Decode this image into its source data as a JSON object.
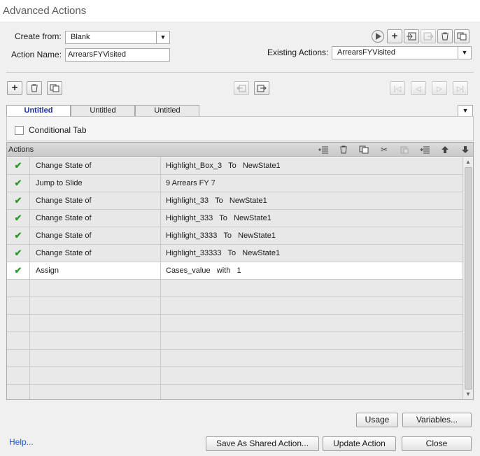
{
  "window": {
    "title": "Advanced Actions"
  },
  "form": {
    "create_from_label": "Create from:",
    "create_from_value": "Blank",
    "action_name_label": "Action Name:",
    "action_name_value": "ArrearsFYVisited",
    "existing_actions_label": "Existing Actions:",
    "existing_actions_value": "ArrearsFYVisited"
  },
  "tabs": [
    {
      "label": "Untitled",
      "active": true
    },
    {
      "label": "Untitled",
      "active": false
    },
    {
      "label": "Untitled",
      "active": false
    }
  ],
  "conditional_tab": {
    "label": "Conditional Tab",
    "checked": false
  },
  "actions_grid": {
    "header": "Actions",
    "rows": [
      {
        "status": "✔",
        "action": "Change State of",
        "params": "Highlight_Box_3   To   NewState1"
      },
      {
        "status": "✔",
        "action": "Jump to Slide",
        "params": "9 Arrears FY 7"
      },
      {
        "status": "✔",
        "action": "Change State of",
        "params": "Highlight_33   To   NewState1"
      },
      {
        "status": "✔",
        "action": "Change State of",
        "params": "Highlight_333   To   NewState1"
      },
      {
        "status": "✔",
        "action": "Change State of",
        "params": "Highlight_3333   To   NewState1"
      },
      {
        "status": "✔",
        "action": "Change State of",
        "params": "Highlight_33333   To   NewState1"
      },
      {
        "status": "✔",
        "action": "Assign",
        "params": "Cases_value   with   1"
      }
    ],
    "selected_row": 6,
    "empty_rows": 7
  },
  "buttons": {
    "usage": "Usage",
    "variables": "Variables...",
    "save_shared": "Save As Shared Action...",
    "update": "Update Action",
    "close": "Close",
    "help": "Help..."
  },
  "colors": {
    "check": "#2c9b2c",
    "active_tab_text": "#1d2fa8",
    "help_link": "#1f5fbf"
  }
}
